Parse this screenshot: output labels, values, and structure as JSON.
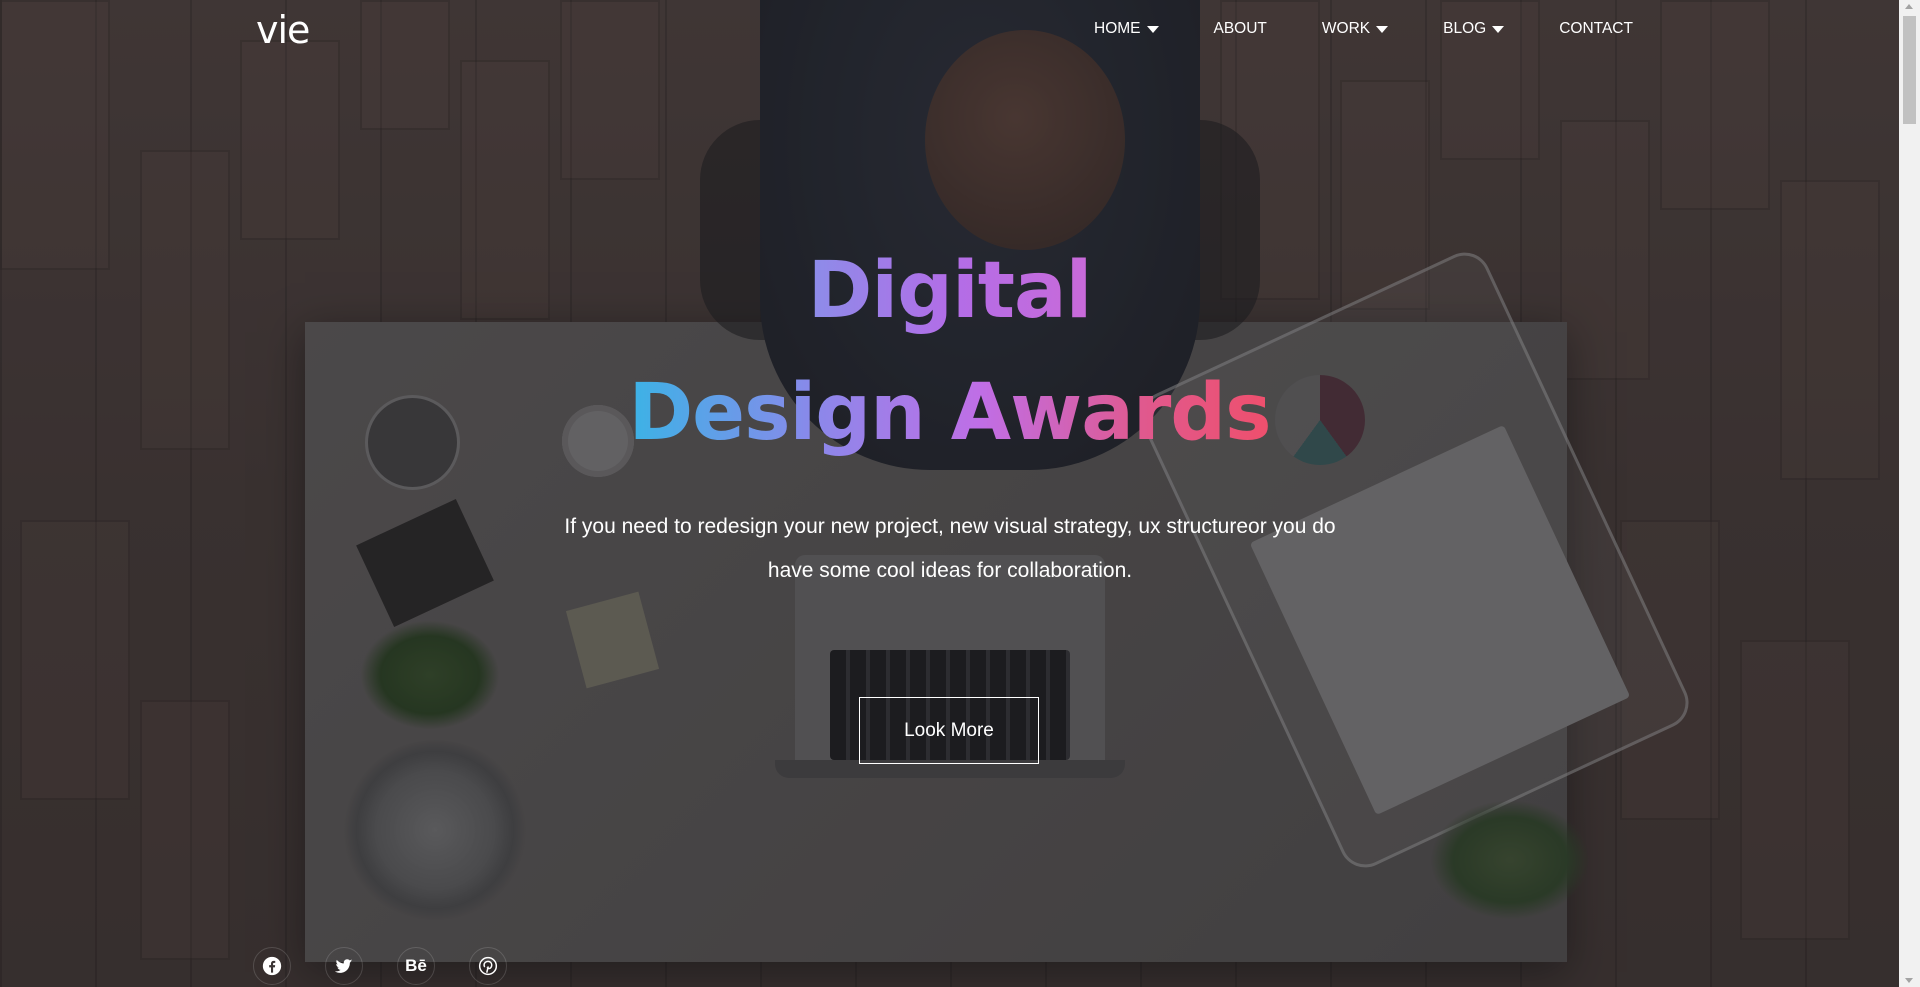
{
  "header": {
    "logo": "vie",
    "nav": [
      {
        "label": "HOME",
        "has_dropdown": true
      },
      {
        "label": "ABOUT",
        "has_dropdown": false
      },
      {
        "label": "WORK",
        "has_dropdown": true
      },
      {
        "label": "BLOG",
        "has_dropdown": true
      },
      {
        "label": "CONTACT",
        "has_dropdown": false
      }
    ]
  },
  "hero": {
    "title_line1": "Digital",
    "title_line2": "Design Awards",
    "subtitle": "If you need to redesign your new project, new visual strategy, ux structureor you do have some cool ideas for collaboration.",
    "cta_label": "Look More",
    "gradient_colors": [
      "#3bb3e6",
      "#8d87ea",
      "#c06ee6",
      "#e0598e",
      "#ef4f6c"
    ]
  },
  "social": [
    {
      "icon": "facebook-icon"
    },
    {
      "icon": "twitter-icon"
    },
    {
      "icon": "behance-icon",
      "glyph": "Bē"
    },
    {
      "icon": "pinterest-icon"
    }
  ]
}
